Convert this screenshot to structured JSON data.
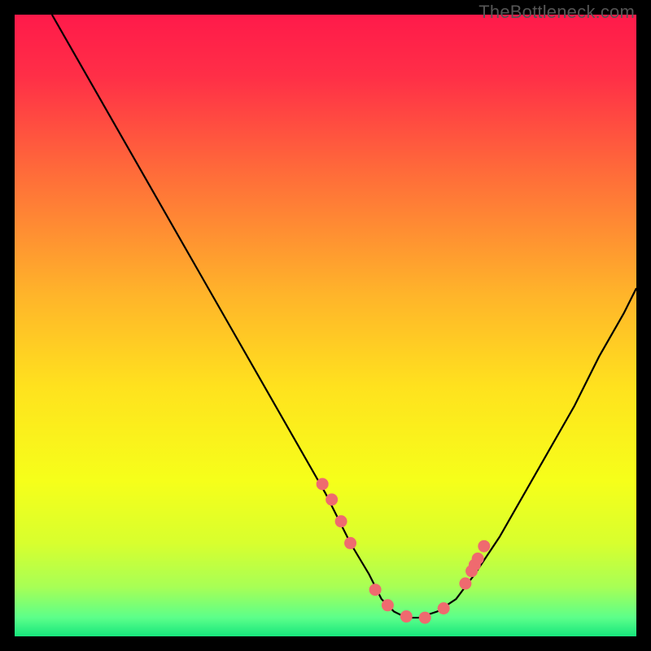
{
  "watermark": "TheBottleneck.com",
  "colors": {
    "gradient_stops": [
      {
        "offset": 0.0,
        "color": "#ff1a4a"
      },
      {
        "offset": 0.1,
        "color": "#ff2f47"
      },
      {
        "offset": 0.25,
        "color": "#ff6a3a"
      },
      {
        "offset": 0.45,
        "color": "#ffb42a"
      },
      {
        "offset": 0.6,
        "color": "#ffe21e"
      },
      {
        "offset": 0.75,
        "color": "#f6ff1a"
      },
      {
        "offset": 0.85,
        "color": "#d8ff2e"
      },
      {
        "offset": 0.92,
        "color": "#a8ff55"
      },
      {
        "offset": 0.97,
        "color": "#5cff8a"
      },
      {
        "offset": 1.0,
        "color": "#16e67c"
      }
    ],
    "curve": "#000000",
    "marker": "#ef6a6f",
    "background": "#000000"
  },
  "chart_data": {
    "type": "line",
    "title": "",
    "xlabel": "",
    "ylabel": "",
    "xlim": [
      0,
      100
    ],
    "ylim": [
      0,
      100
    ],
    "grid": false,
    "legend": false,
    "series": [
      {
        "name": "curve",
        "x": [
          6,
          10,
          14,
          18,
          22,
          26,
          30,
          34,
          38,
          42,
          46,
          50,
          54,
          57,
          59,
          61,
          63,
          65,
          68,
          71,
          74,
          78,
          82,
          86,
          90,
          94,
          98,
          100
        ],
        "y": [
          100,
          93,
          86,
          79,
          72,
          65,
          58,
          51,
          44,
          37,
          30,
          23,
          15,
          10,
          6,
          4,
          3,
          3,
          4,
          6,
          10,
          16,
          23,
          30,
          37,
          45,
          52,
          56
        ]
      }
    ],
    "markers": {
      "name": "highlighted-points",
      "x": [
        49.5,
        51.0,
        52.5,
        54.0,
        58.0,
        60.0,
        63.0,
        66.0,
        69.0,
        72.5,
        73.5,
        74.0,
        74.5,
        75.5
      ],
      "y": [
        24.5,
        22.0,
        18.5,
        15.0,
        7.5,
        5.0,
        3.2,
        3.0,
        4.5,
        8.5,
        10.5,
        11.5,
        12.5,
        14.5
      ]
    }
  }
}
